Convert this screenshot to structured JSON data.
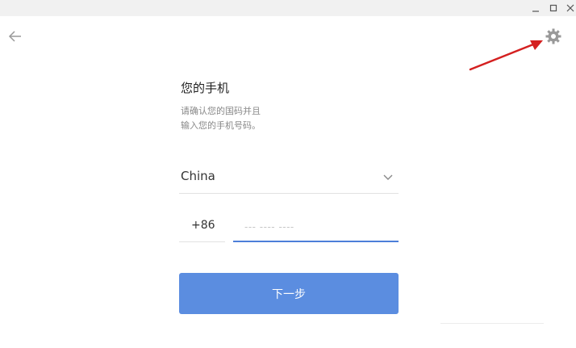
{
  "window": {
    "minimize_icon": "minimize-icon",
    "maximize_icon": "maximize-icon",
    "close_icon": "close-icon"
  },
  "nav": {
    "back_icon": "arrow-left-icon",
    "settings_icon": "gear-icon"
  },
  "annotation": {
    "arrow_color": "#d42020"
  },
  "form": {
    "title": "您的手机",
    "subtitle_line1": "请确认您的国码并且",
    "subtitle_line2": "输入您的手机号码。",
    "country": "China",
    "country_code": "+86",
    "phone_placeholder": "--- ---- ----",
    "next_label": "下一步"
  },
  "colors": {
    "accent": "#5b8de0",
    "input_focus": "#4d7fd9"
  }
}
